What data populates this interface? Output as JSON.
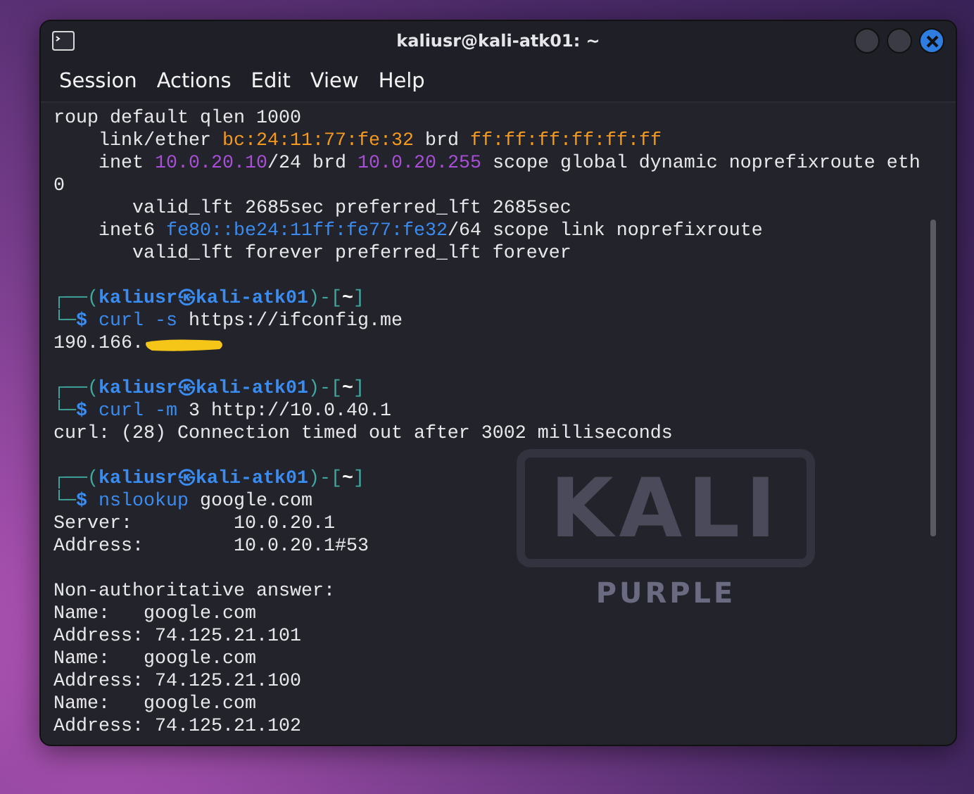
{
  "window": {
    "title": "kaliusr@kali-atk01: ~"
  },
  "menu": [
    "Session",
    "Actions",
    "Edit",
    "View",
    "Help"
  ],
  "background_logo": {
    "title": "KALI",
    "subtitle": "PURPLE"
  },
  "terminal": {
    "lines": [
      {
        "kind": "text",
        "segments": [
          {
            "text": "roup default qlen 1000",
            "kind": "plain"
          }
        ]
      },
      {
        "kind": "text",
        "segments": [
          {
            "text": "    link/ether ",
            "kind": "plain"
          },
          {
            "text": "bc:24:11:77:fe:32",
            "kind": "orange"
          },
          {
            "text": " brd ",
            "kind": "plain"
          },
          {
            "text": "ff:ff:ff:ff:ff:ff",
            "kind": "orange"
          }
        ]
      },
      {
        "kind": "text",
        "segments": [
          {
            "text": "    inet ",
            "kind": "plain"
          },
          {
            "text": "10.0.20.10",
            "kind": "purple"
          },
          {
            "text": "/24 brd ",
            "kind": "plain"
          },
          {
            "text": "10.0.20.255",
            "kind": "purple"
          },
          {
            "text": " scope global dynamic noprefixroute eth",
            "kind": "plain"
          }
        ]
      },
      {
        "kind": "text",
        "segments": [
          {
            "text": "0",
            "kind": "plain"
          }
        ]
      },
      {
        "kind": "text",
        "segments": [
          {
            "text": "       valid_lft 2685sec preferred_lft 2685sec",
            "kind": "plain"
          }
        ]
      },
      {
        "kind": "text",
        "segments": [
          {
            "text": "    inet6 ",
            "kind": "plain"
          },
          {
            "text": "fe80::be24:11ff:fe77:fe32",
            "kind": "blue"
          },
          {
            "text": "/64 scope link noprefixroute",
            "kind": "plain"
          }
        ]
      },
      {
        "kind": "text",
        "segments": [
          {
            "text": "       valid_lft forever preferred_lft forever",
            "kind": "plain"
          }
        ]
      },
      {
        "kind": "blank"
      },
      {
        "kind": "text",
        "segments": [
          {
            "text": "┌──(",
            "kind": "teal"
          },
          {
            "text": "kaliusr㉿kali-atk01",
            "kind": "user"
          },
          {
            "text": ")-[",
            "kind": "teal"
          },
          {
            "text": "~",
            "kind": "bold"
          },
          {
            "text": "]",
            "kind": "teal"
          }
        ]
      },
      {
        "kind": "text",
        "segments": [
          {
            "text": "└─",
            "kind": "teal"
          },
          {
            "text": "$ ",
            "kind": "user"
          },
          {
            "text": "curl",
            "kind": "command"
          },
          {
            "text": " -s",
            "kind": "command"
          },
          {
            "text": " https://ifconfig.me",
            "kind": "plain"
          }
        ]
      },
      {
        "kind": "redacted",
        "segments": [
          {
            "text": "190.166.",
            "kind": "plain"
          }
        ]
      },
      {
        "kind": "blank"
      },
      {
        "kind": "text",
        "segments": [
          {
            "text": "┌──(",
            "kind": "teal"
          },
          {
            "text": "kaliusr㉿kali-atk01",
            "kind": "user"
          },
          {
            "text": ")-[",
            "kind": "teal"
          },
          {
            "text": "~",
            "kind": "bold"
          },
          {
            "text": "]",
            "kind": "teal"
          }
        ]
      },
      {
        "kind": "text",
        "segments": [
          {
            "text": "└─",
            "kind": "teal"
          },
          {
            "text": "$ ",
            "kind": "user"
          },
          {
            "text": "curl",
            "kind": "command"
          },
          {
            "text": " -m",
            "kind": "command"
          },
          {
            "text": " 3 http://10.0.40.1",
            "kind": "plain"
          }
        ]
      },
      {
        "kind": "text",
        "segments": [
          {
            "text": "curl: (28) Connection timed out after 3002 milliseconds",
            "kind": "plain"
          }
        ]
      },
      {
        "kind": "blank"
      },
      {
        "kind": "text",
        "segments": [
          {
            "text": "┌──(",
            "kind": "teal"
          },
          {
            "text": "kaliusr㉿kali-atk01",
            "kind": "user"
          },
          {
            "text": ")-[",
            "kind": "teal"
          },
          {
            "text": "~",
            "kind": "bold"
          },
          {
            "text": "]",
            "kind": "teal"
          }
        ]
      },
      {
        "kind": "text",
        "segments": [
          {
            "text": "└─",
            "kind": "teal"
          },
          {
            "text": "$ ",
            "kind": "user"
          },
          {
            "text": "nslookup",
            "kind": "command"
          },
          {
            "text": " google.com",
            "kind": "plain"
          }
        ]
      },
      {
        "kind": "text",
        "segments": [
          {
            "text": "Server:         10.0.20.1",
            "kind": "plain"
          }
        ]
      },
      {
        "kind": "text",
        "segments": [
          {
            "text": "Address:        10.0.20.1#53",
            "kind": "plain"
          }
        ]
      },
      {
        "kind": "blank"
      },
      {
        "kind": "text",
        "segments": [
          {
            "text": "Non-authoritative answer:",
            "kind": "plain"
          }
        ]
      },
      {
        "kind": "text",
        "segments": [
          {
            "text": "Name:   google.com",
            "kind": "plain"
          }
        ]
      },
      {
        "kind": "text",
        "segments": [
          {
            "text": "Address: 74.125.21.101",
            "kind": "plain"
          }
        ]
      },
      {
        "kind": "text",
        "segments": [
          {
            "text": "Name:   google.com",
            "kind": "plain"
          }
        ]
      },
      {
        "kind": "text",
        "segments": [
          {
            "text": "Address: 74.125.21.100",
            "kind": "plain"
          }
        ]
      },
      {
        "kind": "text",
        "segments": [
          {
            "text": "Name:   google.com",
            "kind": "plain"
          }
        ]
      },
      {
        "kind": "text",
        "segments": [
          {
            "text": "Address: 74.125.21.102",
            "kind": "plain"
          }
        ]
      }
    ]
  }
}
